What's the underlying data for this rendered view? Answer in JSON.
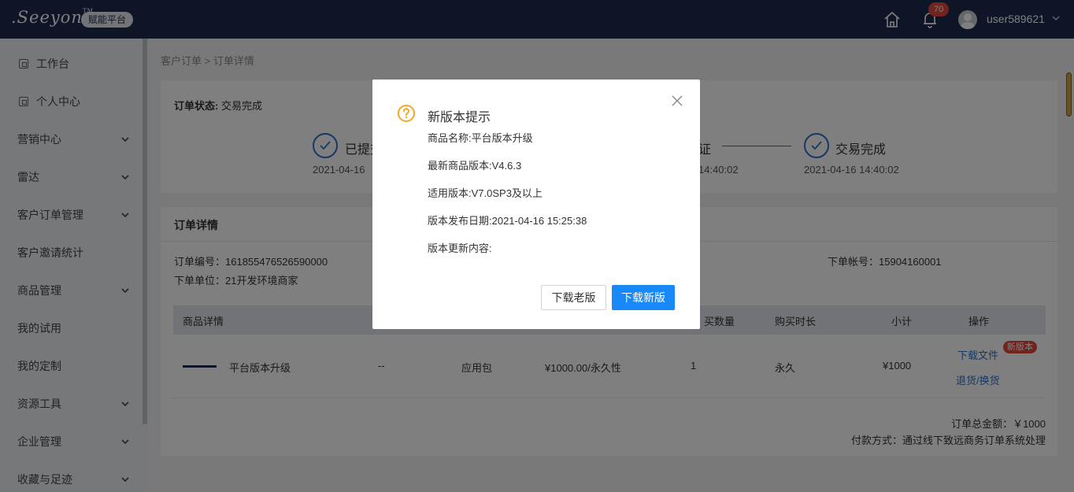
{
  "header": {
    "logo_text": ".Seeyon",
    "logo_tm": "TM",
    "badge": "赋能平台",
    "notification_count": "70",
    "username": "user589621"
  },
  "sidebar": {
    "items": [
      {
        "label": "工作台"
      },
      {
        "label": "个人中心"
      },
      {
        "label": "营销中心"
      },
      {
        "label": "雷达"
      },
      {
        "label": "客户订单管理"
      },
      {
        "label": "客户邀请统计"
      },
      {
        "label": "商品管理"
      },
      {
        "label": "我的试用"
      },
      {
        "label": "我的定制"
      },
      {
        "label": "资源工具"
      },
      {
        "label": "企业管理"
      },
      {
        "label": "收藏与足迹"
      }
    ]
  },
  "breadcrumb": "客户订单 > 订单详情",
  "order_status": {
    "label": "订单状态:",
    "value": "交易完成",
    "steps": [
      {
        "title": "已提交",
        "time": "2021-04-16"
      },
      {
        "title": "证",
        "time": "14:40:02"
      },
      {
        "title": "交易完成",
        "time": "2021-04-16 14:40:02"
      }
    ]
  },
  "order_detail": {
    "title": "订单详情",
    "order_no": "订单编号：161855476526590000",
    "order_unit": "下单单位：21开发环境商家",
    "order_account": "下单帐号：15904160001",
    "columns": [
      "商品详情",
      "买数量",
      "购买时长",
      "小计",
      "操作"
    ],
    "row": {
      "name": "平台版本升级",
      "spec": "--",
      "type": "应用包",
      "price": "¥1000.00/永久性",
      "qty": "1",
      "duration": "永久",
      "subtotal": "¥1000",
      "download": "下载文件",
      "new_badge": "新版本",
      "return": "退货/换货"
    },
    "total": "订单总金额：￥1000",
    "payment": "付款方式：通过线下致远商务订单系统处理"
  },
  "modal": {
    "title": "新版本提示",
    "lines": [
      "商品名称:平台版本升级",
      "最新商品版本:V4.6.3",
      "适用版本:V7.0SP3及以上",
      "版本发布日期:2021-04-16 15:25:38",
      "版本更新内容:"
    ],
    "btn_old": "下载老版",
    "btn_new": "下载新版"
  }
}
